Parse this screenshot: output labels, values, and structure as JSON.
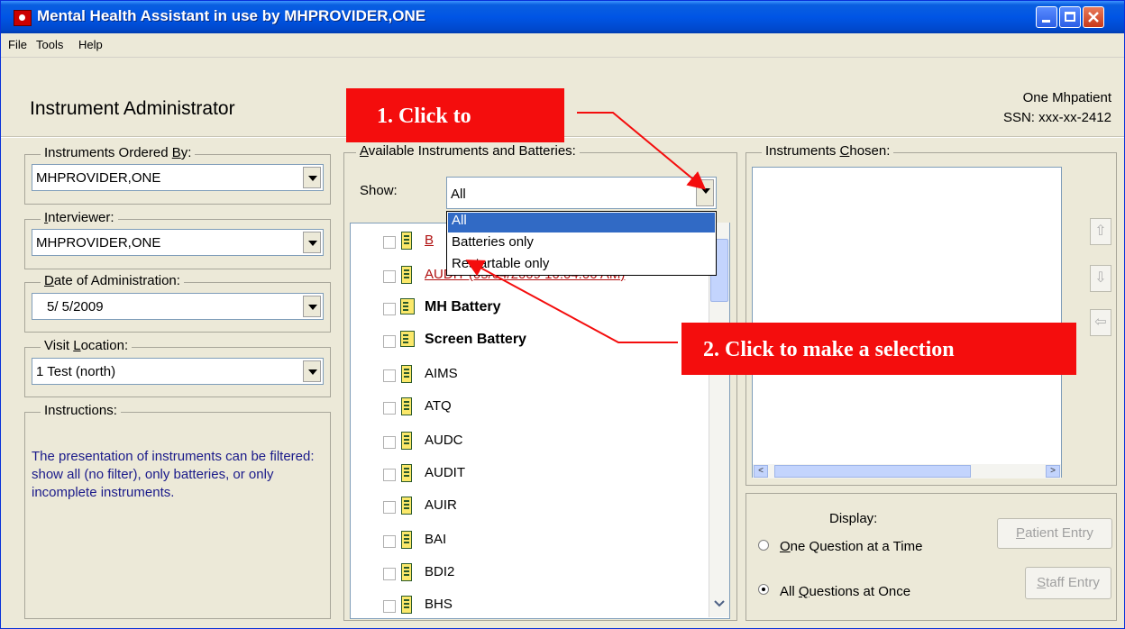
{
  "window": {
    "title": "Mental Health Assistant in use by MHPROVIDER,ONE",
    "controls": {
      "minimize": "minimize-icon",
      "maximize": "maximize-icon",
      "close": "close-icon"
    }
  },
  "menu": [
    "File",
    "Tools",
    "Help"
  ],
  "header": {
    "title": "Instrument Administrator",
    "patient_name": "One Mhpatient",
    "patient_ssn": "SSN: xxx-xx-2412"
  },
  "left": {
    "ordered_by": {
      "label_pre": "Instruments Ordered ",
      "label_ul": "B",
      "label_post": "y:",
      "value": "MHPROVIDER,ONE"
    },
    "interviewer": {
      "label_ul": "I",
      "label_post": "nterviewer:",
      "value": "MHPROVIDER,ONE"
    },
    "date": {
      "label_ul": "D",
      "label_post": "ate of Administration:",
      "value": "5/ 5/2009"
    },
    "location": {
      "label_pre": "Visit ",
      "label_ul": "L",
      "label_post": "ocation:",
      "value": "1 Test (north)"
    },
    "instructions": {
      "label": "Instructions:",
      "text": "The presentation of instruments can be filtered: show all (no filter), only batteries, or only incomplete instruments."
    }
  },
  "available": {
    "label_ul": "A",
    "label_post": "vailable Instruments and Batteries:",
    "show_label": "Show:",
    "show_value": "All",
    "dropdown_options": [
      "All",
      "Batteries only",
      "Restartable only"
    ],
    "selected_option": "All",
    "items": [
      {
        "name": "B",
        "style": "red"
      },
      {
        "name": "AUDIT (05/04/2009 10:04:06 AM)",
        "style": "red"
      },
      {
        "name": "MH Battery",
        "style": "bold"
      },
      {
        "name": "Screen Battery",
        "style": "bold"
      },
      {
        "name": "AIMS",
        "style": "normal"
      },
      {
        "name": "ATQ",
        "style": "normal"
      },
      {
        "name": "AUDC",
        "style": "normal"
      },
      {
        "name": "AUDIT",
        "style": "normal"
      },
      {
        "name": "AUIR",
        "style": "normal"
      },
      {
        "name": "BAI",
        "style": "normal"
      },
      {
        "name": "BDI2",
        "style": "normal"
      },
      {
        "name": "BHS",
        "style": "normal"
      }
    ]
  },
  "chosen": {
    "label_pre": "Instruments ",
    "label_ul": "C",
    "label_post": "hosen:",
    "move_up": "up-arrow-icon",
    "move_down": "down-arrow-icon",
    "remove": "left-arrow-icon"
  },
  "display": {
    "label": "Display:",
    "one_at_time": {
      "ul": "O",
      "post": "ne Question at a Time"
    },
    "all_at_once": {
      "pre": "All ",
      "ul": "Q",
      "post": "uestions at Once"
    },
    "selected": "all_at_once"
  },
  "buttons": {
    "patient_entry": {
      "ul": "P",
      "post": "atient Entry"
    },
    "staff_entry": {
      "ul": "S",
      "post": "taff Entry"
    }
  },
  "callouts": {
    "one": "1. Click to",
    "two": "2. Click to make a selection",
    "color": "#f40d0d"
  }
}
